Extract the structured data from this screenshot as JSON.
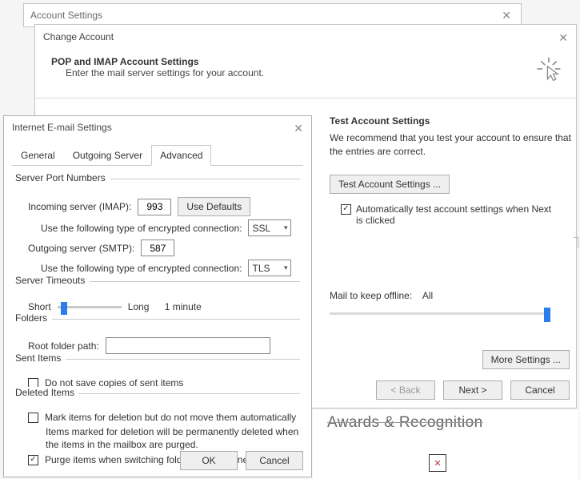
{
  "account_settings": {
    "title": "Account Settings"
  },
  "change_account": {
    "title": "Change Account",
    "heading": "POP and IMAP Account Settings",
    "subheading": "Enter the mail server settings for your account.",
    "test_heading": "Test Account Settings",
    "test_body": "We recommend that you test your account to ensure that the entries are correct.",
    "test_button": "Test Account Settings ...",
    "auto_test_label": "Automatically test account settings when Next is clicked",
    "auto_test_checked": true,
    "mail_offline_label": "Mail to keep offline:",
    "mail_offline_value": "All",
    "more_settings": "More Settings ...",
    "back": "< Back",
    "next": "Next >",
    "cancel": "Cancel"
  },
  "inet": {
    "title": "Internet E-mail Settings",
    "tabs": {
      "general": "General",
      "outgoing": "Outgoing Server",
      "advanced": "Advanced"
    },
    "server_ports": {
      "legend": "Server Port Numbers",
      "incoming_label": "Incoming server (IMAP):",
      "incoming_value": "993",
      "use_defaults": "Use Defaults",
      "enc_label": "Use the following type of encrypted connection:",
      "incoming_enc": "SSL",
      "outgoing_label": "Outgoing server (SMTP):",
      "outgoing_value": "587",
      "outgoing_enc": "TLS"
    },
    "timeouts": {
      "legend": "Server Timeouts",
      "short": "Short",
      "long": "Long",
      "value": "1 minute"
    },
    "folders": {
      "legend": "Folders",
      "root_label": "Root folder path:",
      "root_value": ""
    },
    "sent": {
      "legend": "Sent Items",
      "nosave_label": "Do not save copies of sent items",
      "nosave_checked": false
    },
    "deleted": {
      "legend": "Deleted Items",
      "mark_label": "Mark items for deletion but do not move them automatically",
      "mark_checked": false,
      "mark_note": "Items marked for deletion will be permanently deleted when the items in the mailbox are purged.",
      "purge_label": "Purge items when switching folders while online",
      "purge_checked": true
    },
    "ok": "OK",
    "cancel": "Cancel"
  },
  "background": {
    "heading": "Awards & Recognition",
    "broken": "✕"
  }
}
